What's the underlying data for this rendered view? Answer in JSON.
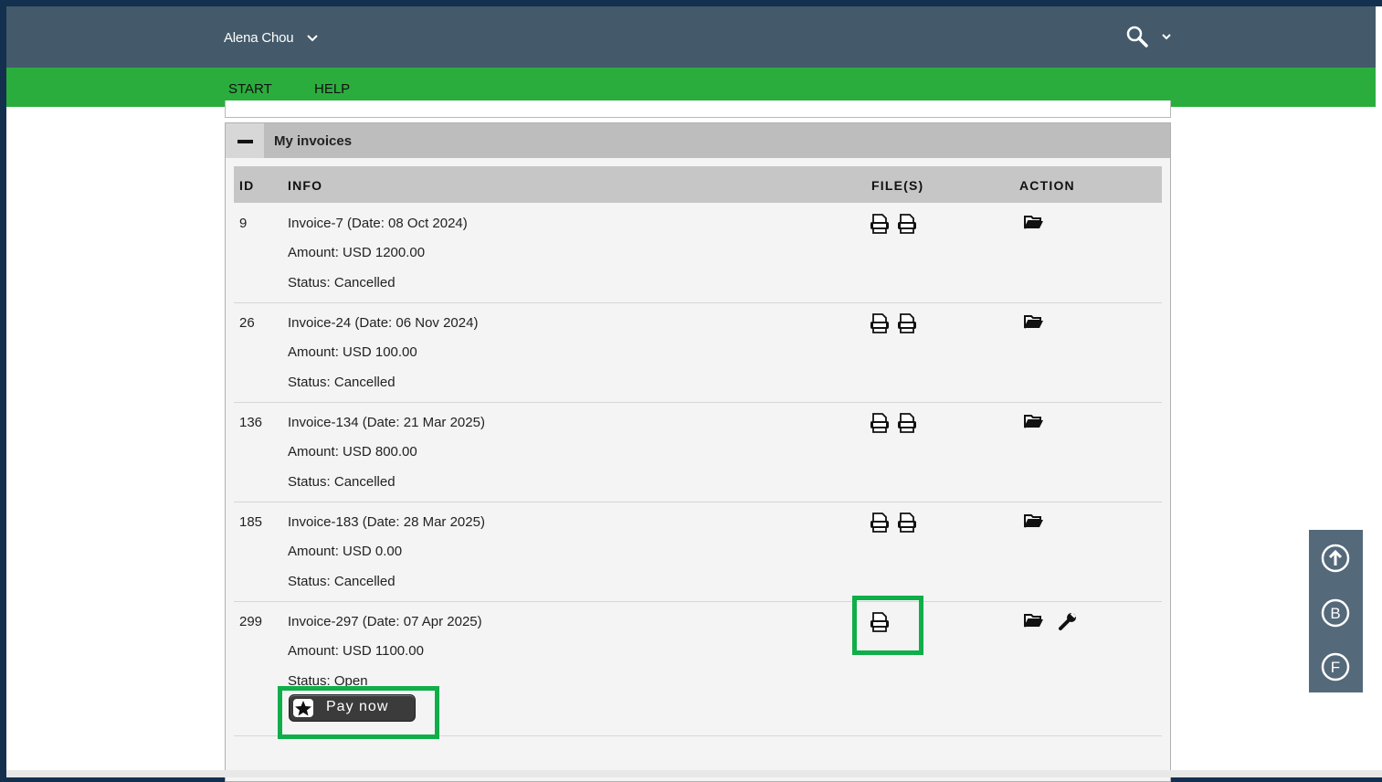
{
  "header": {
    "user_name": "Alena Chou"
  },
  "nav": {
    "items": [
      {
        "label": "START"
      },
      {
        "label": "HELP"
      }
    ]
  },
  "panel": {
    "title": "My invoices",
    "columns": {
      "id": "ID",
      "info": "INFO",
      "files": "FILE(S)",
      "action": "ACTION"
    },
    "rows": [
      {
        "id": "9",
        "invoice": "Invoice-7 (Date: 08 Oct 2024)",
        "amount": "Amount: USD 1200.00",
        "status": "Status: Cancelled",
        "files": [
          "pdf-file-icon",
          "pdf-file-icon"
        ],
        "actions": [
          "folder-open-icon"
        ]
      },
      {
        "id": "26",
        "invoice": "Invoice-24 (Date: 06 Nov 2024)",
        "amount": "Amount: USD 100.00",
        "status": "Status: Cancelled",
        "files": [
          "pdf-file-icon",
          "pdf-file-icon"
        ],
        "actions": [
          "folder-open-icon"
        ]
      },
      {
        "id": "136",
        "invoice": "Invoice-134 (Date: 21 Mar 2025)",
        "amount": "Amount: USD 800.00",
        "status": "Status: Cancelled",
        "files": [
          "pdf-file-icon",
          "pdf-file-icon"
        ],
        "actions": [
          "folder-open-icon"
        ]
      },
      {
        "id": "185",
        "invoice": "Invoice-183 (Date: 28 Mar 2025)",
        "amount": "Amount: USD 0.00",
        "status": "Status: Cancelled",
        "files": [
          "pdf-file-icon",
          "pdf-file-icon"
        ],
        "actions": [
          "folder-open-icon"
        ]
      },
      {
        "id": "299",
        "invoice": "Invoice-297 (Date: 07 Apr 2025)",
        "amount": "Amount: USD 1100.00",
        "status": "Status: Open",
        "files": [
          "pdf-file-icon"
        ],
        "actions": [
          "folder-open-icon",
          "wrench-icon"
        ],
        "pay_button": "Pay now"
      }
    ]
  },
  "side_tools": {
    "items": [
      "arrow-up-circle-icon",
      "b-circle-icon",
      "f-circle-icon"
    ]
  },
  "colors": {
    "topbar": "#445a6a",
    "navbar": "#2aad3d",
    "highlight": "#0fae49",
    "outer": "#14304f"
  }
}
